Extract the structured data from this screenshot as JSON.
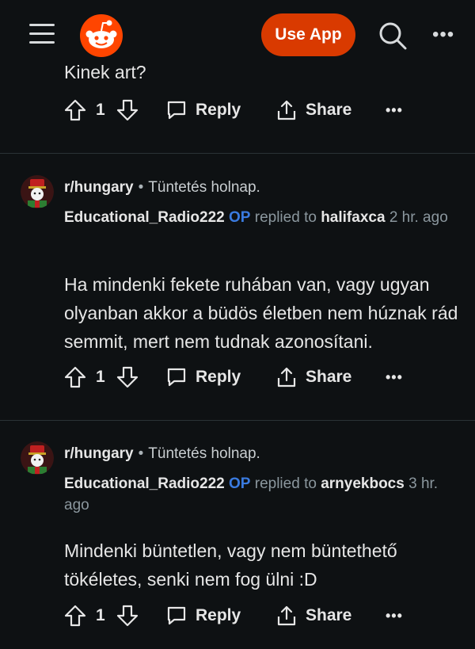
{
  "header": {
    "use_app_label": "Use App",
    "accent": "#d93a00"
  },
  "partial": {
    "text": "Kinek art?",
    "votes": "1",
    "reply_label": "Reply",
    "share_label": "Share"
  },
  "comments": [
    {
      "subreddit": "r/hungary",
      "post_title": "Tüntetés holnap.",
      "author": "Educational_Radio222",
      "op_badge": "OP",
      "replied_to_label": "replied to",
      "replied_to": "halifaxca",
      "time": "2 hr. ago",
      "body": "Ha mindenki fekete ruhában van, vagy ugyan olyanban akkor a büdös életben nem húznak rád semmit, mert nem tudnak azonosítani.",
      "votes": "1",
      "reply_label": "Reply",
      "share_label": "Share"
    },
    {
      "subreddit": "r/hungary",
      "post_title": "Tüntetés holnap.",
      "author": "Educational_Radio222",
      "op_badge": "OP",
      "replied_to_label": "replied to",
      "replied_to": "arnyekbocs",
      "time": "3 hr. ago",
      "body": "Mindenki büntetlen, vagy nem büntethető tökéletes, senki nem fog ülni :D",
      "votes": "1",
      "reply_label": "Reply",
      "share_label": "Share"
    }
  ]
}
